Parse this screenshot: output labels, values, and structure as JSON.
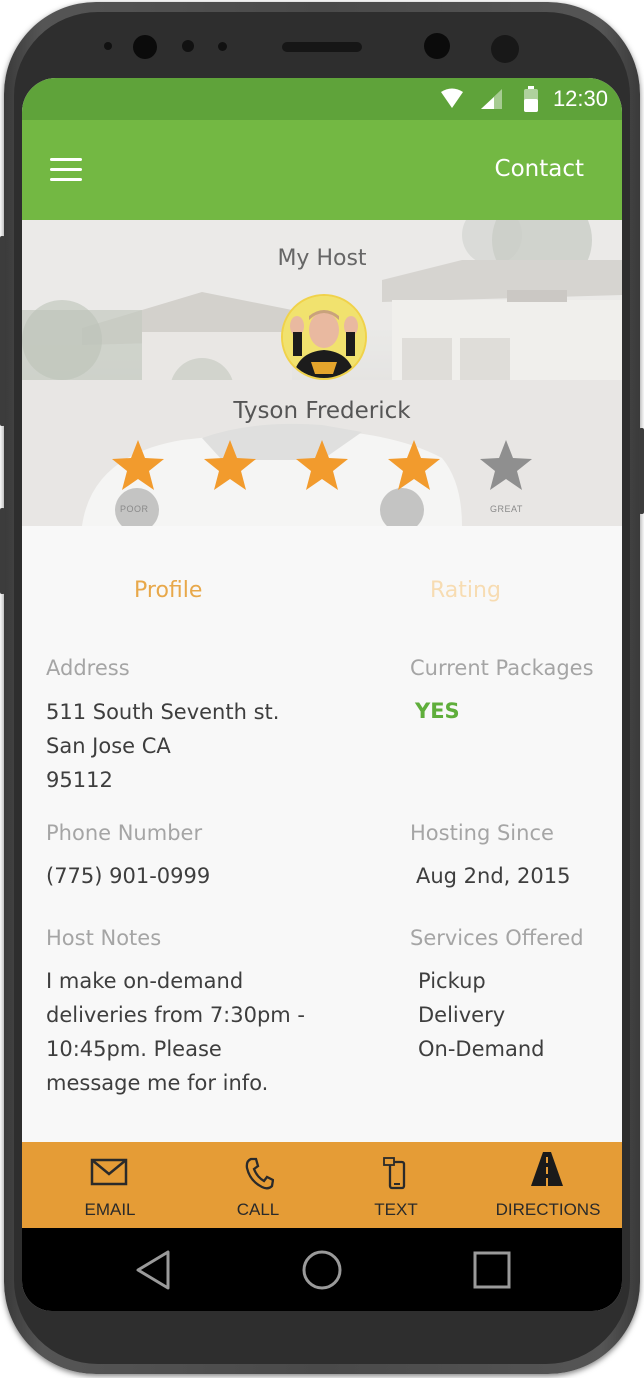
{
  "status_bar": {
    "time": "12:30"
  },
  "app_bar": {
    "contact_label": "Contact"
  },
  "hero": {
    "title": "My Host",
    "host_name": "Tyson Frederick",
    "rating": {
      "value": 4,
      "max": 5,
      "low_label": "POOR",
      "high_label": "GREAT"
    }
  },
  "tabs": {
    "profile": "Profile",
    "rating": "Rating",
    "active": "Profile"
  },
  "profile": {
    "address_label": "Address",
    "address_lines": [
      "511 South Seventh st.",
      "San Jose CA",
      "95112"
    ],
    "current_packages_label": "Current Packages",
    "current_packages_value": "YES",
    "phone_label": "Phone Number",
    "phone_value": "(775) 901-0999",
    "hosting_since_label": "Hosting Since",
    "hosting_since_value": "Aug 2nd, 2015",
    "notes_label": "Host Notes",
    "notes_lines": [
      "I make on-demand",
      "deliveries from 7:30pm -",
      "10:45pm.  Please",
      "message me for info."
    ],
    "services_label": "Services Offered",
    "services": [
      "Pickup",
      "Delivery",
      "On-Demand"
    ]
  },
  "actions": [
    {
      "label": "EMAIL",
      "icon": "envelope-icon"
    },
    {
      "label": "CALL",
      "icon": "phone-icon"
    },
    {
      "label": "TEXT",
      "icon": "message-phone-icon"
    },
    {
      "label": "DIRECTIONS",
      "icon": "road-icon"
    }
  ],
  "colors": {
    "status_bar": "#5fa33a",
    "app_bar": "#73b843",
    "accent_orange": "#e59c36",
    "star_filled": "#f29b2d",
    "star_empty": "#8f8f8f",
    "yes_green": "#5fae3b"
  }
}
